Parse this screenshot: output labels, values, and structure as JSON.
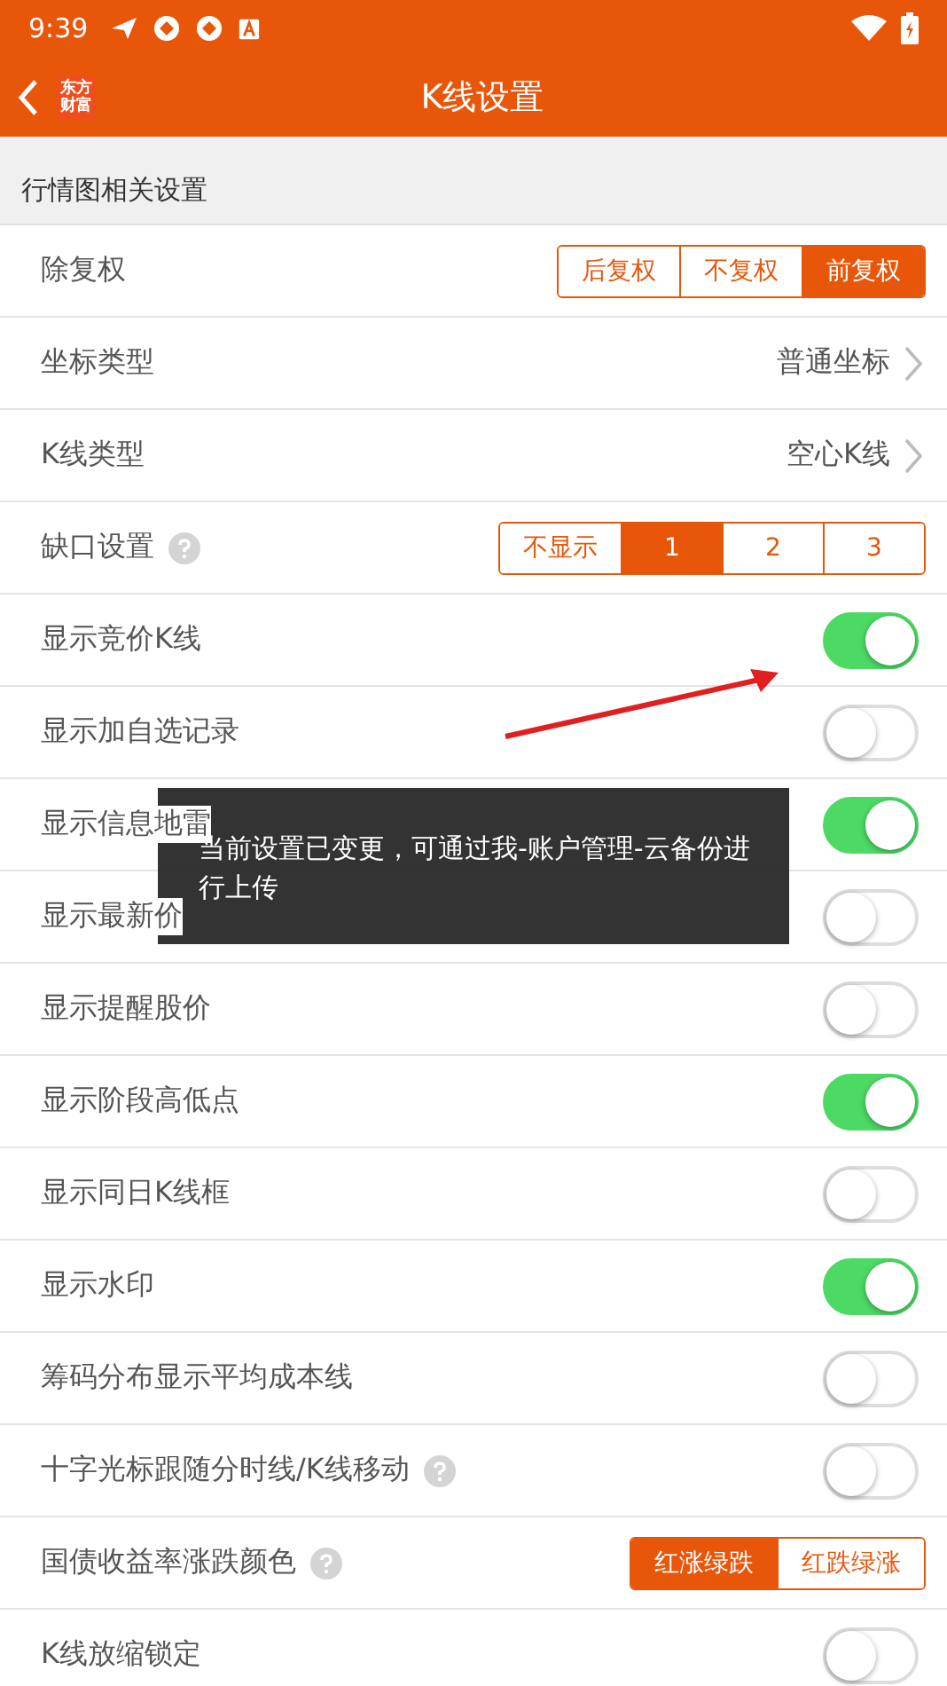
{
  "status_bar": {
    "time": "9:39"
  },
  "header": {
    "logo": [
      "东方",
      "财富"
    ],
    "title": "K线设置"
  },
  "section": {
    "title": "行情图相关设置"
  },
  "rows": [
    {
      "kind": "segmented",
      "label": "除复权",
      "help": false,
      "options": [
        {
          "label": "后复权",
          "selected": false
        },
        {
          "label": "不复权",
          "selected": false
        },
        {
          "label": "前复权",
          "selected": true
        }
      ]
    },
    {
      "kind": "select",
      "label": "坐标类型",
      "help": false,
      "value": "普通坐标"
    },
    {
      "kind": "select",
      "label": "K线类型",
      "help": false,
      "value": "空心K线"
    },
    {
      "kind": "segmented",
      "label": "缺口设置",
      "help": true,
      "options": [
        {
          "label": "不显示",
          "selected": false
        },
        {
          "label": "1",
          "selected": true
        },
        {
          "label": "2",
          "selected": false
        },
        {
          "label": "3",
          "selected": false
        }
      ]
    },
    {
      "kind": "toggle",
      "label": "显示竞价K线",
      "help": false,
      "on": true
    },
    {
      "kind": "toggle",
      "label": "显示加自选记录",
      "help": false,
      "on": false
    },
    {
      "kind": "toggle",
      "label": "显示信息地雷",
      "help": false,
      "on": true
    },
    {
      "kind": "toggle",
      "label": "显示最新价",
      "help": false,
      "on": false
    },
    {
      "kind": "toggle",
      "label": "显示提醒股价",
      "help": false,
      "on": false
    },
    {
      "kind": "toggle",
      "label": "显示阶段高低点",
      "help": false,
      "on": true
    },
    {
      "kind": "toggle",
      "label": "显示同日K线框",
      "help": false,
      "on": false
    },
    {
      "kind": "toggle",
      "label": "显示水印",
      "help": false,
      "on": true
    },
    {
      "kind": "toggle",
      "label": "筹码分布显示平均成本线",
      "help": false,
      "on": false
    },
    {
      "kind": "toggle",
      "label": "十字光标跟随分时线/K线移动",
      "help": true,
      "on": false
    },
    {
      "kind": "segmented",
      "label": "国债收益率涨跌颜色",
      "help": true,
      "options": [
        {
          "label": "红涨绿跌",
          "selected": true
        },
        {
          "label": "红跌绿涨",
          "selected": false
        }
      ]
    },
    {
      "kind": "toggle",
      "label": "K线放缩锁定",
      "help": false,
      "on": false
    }
  ],
  "toast": {
    "text": "当前设置已变更，可通过我-账户管理-云备份进行上传"
  }
}
